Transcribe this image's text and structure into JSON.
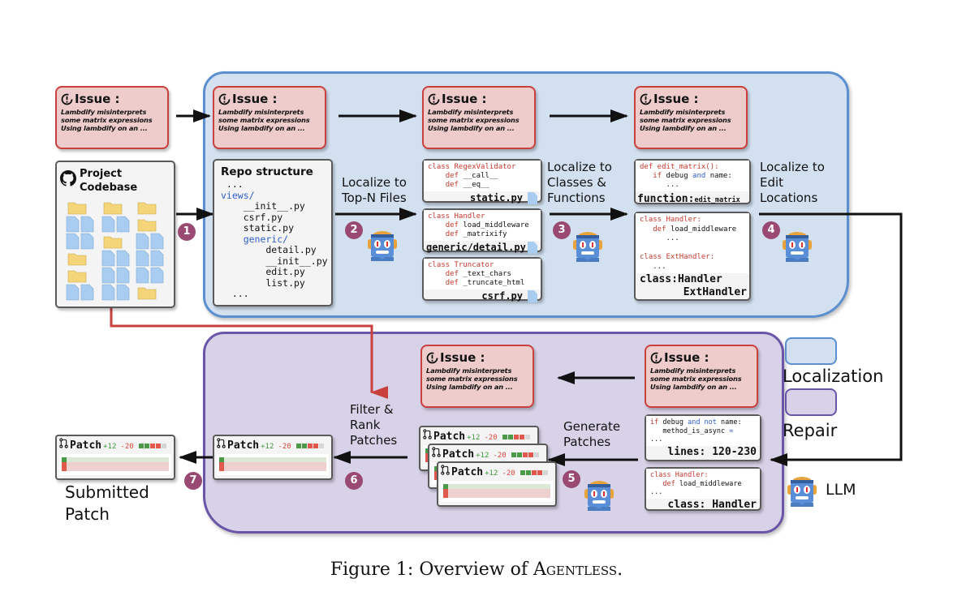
{
  "issue": {
    "title": "Issue :",
    "lines": [
      "Lambdify misinterprets",
      "some matrix expressions",
      "Using lambdify on an ..."
    ]
  },
  "codebase": {
    "title_line1": "Project",
    "title_line2": "Codebase"
  },
  "repo_structure": {
    "title": "Repo structure",
    "lines": [
      {
        "text": " ...",
        "kind": "plain"
      },
      {
        "text": "views/",
        "kind": "dir"
      },
      {
        "text": "    __init__.py",
        "kind": "plain"
      },
      {
        "text": "    csrf.py",
        "kind": "plain"
      },
      {
        "text": "    static.py",
        "kind": "plain"
      },
      {
        "text": "    generic/",
        "kind": "dir"
      },
      {
        "text": "        detail.py",
        "kind": "plain"
      },
      {
        "text": "        __init__.py",
        "kind": "plain"
      },
      {
        "text": "        edit.py",
        "kind": "plain"
      },
      {
        "text": "        list.py",
        "kind": "plain"
      },
      {
        "text": "  ...",
        "kind": "plain"
      }
    ]
  },
  "steps": {
    "s1": "1",
    "s2": "2",
    "s3": "3",
    "s4": "4",
    "s5": "5",
    "s6": "6",
    "s7": "7"
  },
  "labels": {
    "top_n_line1": "Localize to",
    "top_n_line2": "Top-N Files",
    "classes_line1": "Localize to",
    "classes_line2": "Classes &",
    "classes_line3": "Functions",
    "edit_line1": "Localize to",
    "edit_line2": "Edit",
    "edit_line3": "Locations",
    "filter_line1": "Filter &",
    "filter_line2": "Rank",
    "filter_line3": "Patches",
    "generate_line1": "Generate",
    "generate_line2": "Patches",
    "submitted_line1": "Submitted",
    "submitted_line2": "Patch"
  },
  "files": [
    {
      "class_kw": "class",
      "class_name": "RegexValidator",
      "defs": [
        "__call__",
        "__eq__"
      ],
      "filename": "static.py"
    },
    {
      "class_kw": "class",
      "class_name": "Handler",
      "defs": [
        "load_middleware",
        "_matrixify"
      ],
      "filename": "generic/detail.py"
    },
    {
      "class_kw": "class",
      "class_name": "Truncator",
      "defs": [
        "_text_chars",
        "_truncate_html"
      ],
      "filename": "csrf.py"
    }
  ],
  "functions_card": {
    "line1_kw": "def",
    "line1_rest": " edit_matrix():",
    "line2_if": "if",
    "line2_a": " debug ",
    "line2_and": "and",
    "line2_b": " name:",
    "line3": "...",
    "footer_label": "function:",
    "footer_value": "edit_matrix"
  },
  "classes_card": {
    "c1_kw": "class",
    "c1_name": " Handler:",
    "c1_def_kw": "def",
    "c1_def": " load_middleware",
    "c1_dots": "...",
    "c2_kw": "class",
    "c2_name": " ExtHandler:",
    "c2_dots": "...",
    "footer_line1": "class:Handler",
    "footer_line2": "ExtHandler"
  },
  "lines_card": {
    "if": "if",
    "a": " debug ",
    "and": "and",
    "not": " not",
    "b": " name:",
    "line2": "method_is_async",
    "line2_eq": " =",
    "line3": "...",
    "footer": "lines: 120-230"
  },
  "handler_card": {
    "kw": "class",
    "name": " Handler:",
    "def_kw": "def",
    "def": " load_middleware",
    "dots": "...",
    "footer": "class: Handler"
  },
  "patch": {
    "title": "Patch",
    "additions": "+12",
    "deletions": "-20",
    "diffstat": [
      "add",
      "add",
      "del",
      "del",
      "neutral"
    ]
  },
  "legend": {
    "localization": "Localization",
    "repair": "Repair",
    "llm": "LLM"
  },
  "colors": {
    "localization_fill": "#d3e0f0",
    "localization_border": "#5b8fd0",
    "repair_fill": "#d8d2e8",
    "repair_border": "#6b55a8",
    "issue_fill": "#efcccc",
    "issue_border": "#c9403d",
    "badge": "#9a4a72",
    "codebase_arrow": "#c9403d"
  },
  "caption": {
    "prefix": "Figure 1: Overview of ",
    "name": "Agentless",
    "suffix": "."
  }
}
